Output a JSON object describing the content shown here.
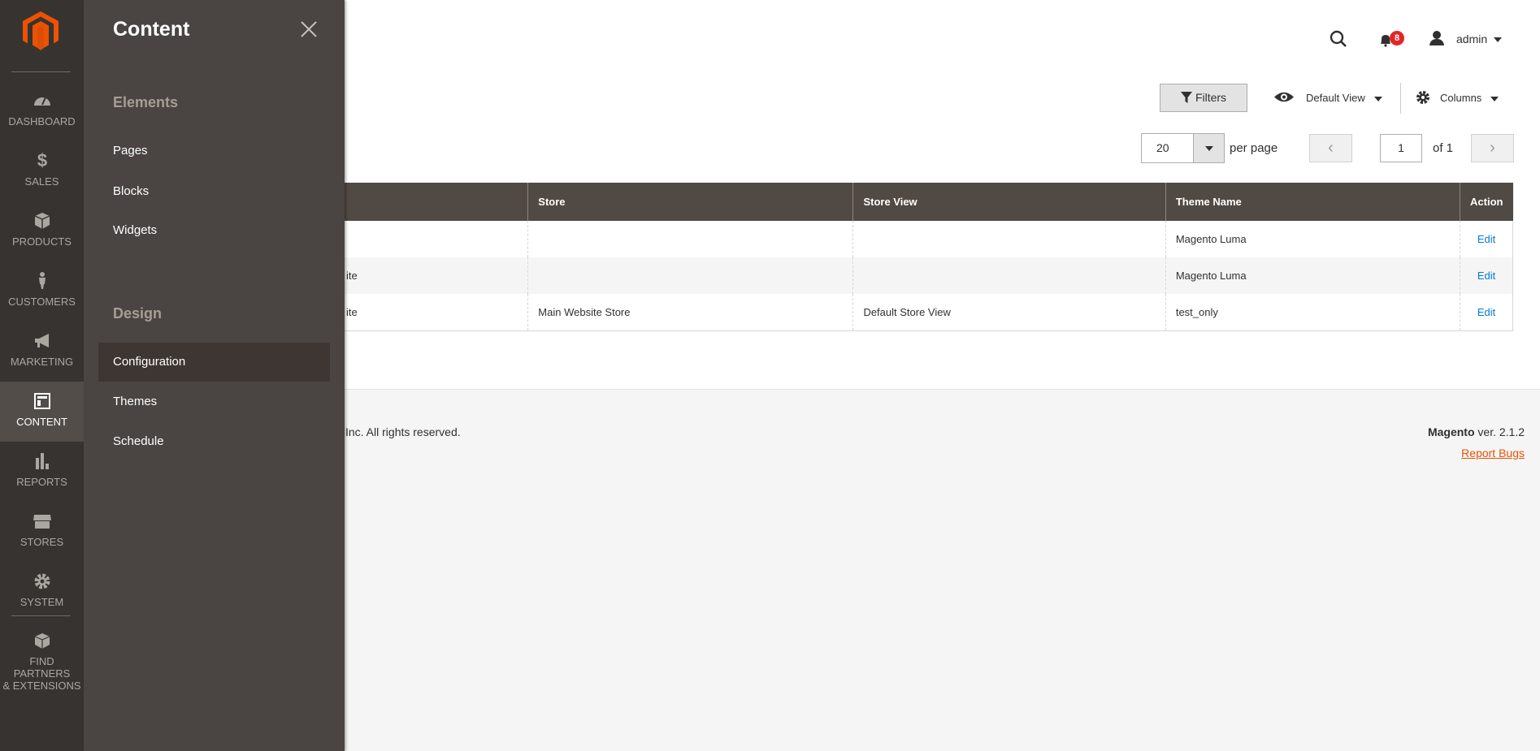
{
  "nav": {
    "items": [
      {
        "label": "DASHBOARD",
        "icon": "dashboard-icon"
      },
      {
        "label": "SALES",
        "icon": "dollar-icon"
      },
      {
        "label": "PRODUCTS",
        "icon": "box-icon"
      },
      {
        "label": "CUSTOMERS",
        "icon": "person-icon"
      },
      {
        "label": "MARKETING",
        "icon": "megaphone-icon"
      },
      {
        "label": "CONTENT",
        "icon": "layout-icon",
        "active": true
      },
      {
        "label": "REPORTS",
        "icon": "bar-chart-icon"
      },
      {
        "label": "STORES",
        "icon": "storefront-icon"
      },
      {
        "label": "SYSTEM",
        "icon": "gear-icon"
      },
      {
        "label": "FIND PARTNERS",
        "label2": "& EXTENSIONS",
        "icon": "blocks-icon"
      }
    ]
  },
  "panel": {
    "title": "Content",
    "groups": [
      {
        "title": "Elements",
        "items": [
          "Pages",
          "Blocks",
          "Widgets"
        ]
      },
      {
        "title": "Design",
        "items": [
          "Configuration",
          "Themes",
          "Schedule"
        ]
      }
    ]
  },
  "header": {
    "notifications": "8",
    "user": "admin"
  },
  "toolbar": {
    "filters": "Filters",
    "view": "Default View",
    "columns": "Columns"
  },
  "pager": {
    "per_page_value": "20",
    "per_page_label": "per page",
    "page": "1",
    "of": "of 1"
  },
  "table": {
    "headers": [
      "",
      "Store",
      "Store View",
      "Theme Name",
      "Action"
    ],
    "rows": [
      [
        "",
        "",
        "",
        "Magento Luma",
        "Edit"
      ],
      [
        "ite",
        "",
        "",
        "Magento Luma",
        "Edit"
      ],
      [
        "ite",
        "Main Website Store",
        "Default Store View",
        "test_only",
        "Edit"
      ]
    ]
  },
  "footer": {
    "copyright": "Inc. All rights reserved.",
    "brand": "Magento",
    "version": " ver. 2.1.2",
    "report": "Report Bugs"
  },
  "colors": {
    "accent": "#eb5202",
    "nav": "#373330",
    "panel": "#4a4542",
    "header": "#514943",
    "link": "#007bdb",
    "badge": "#e22626"
  }
}
